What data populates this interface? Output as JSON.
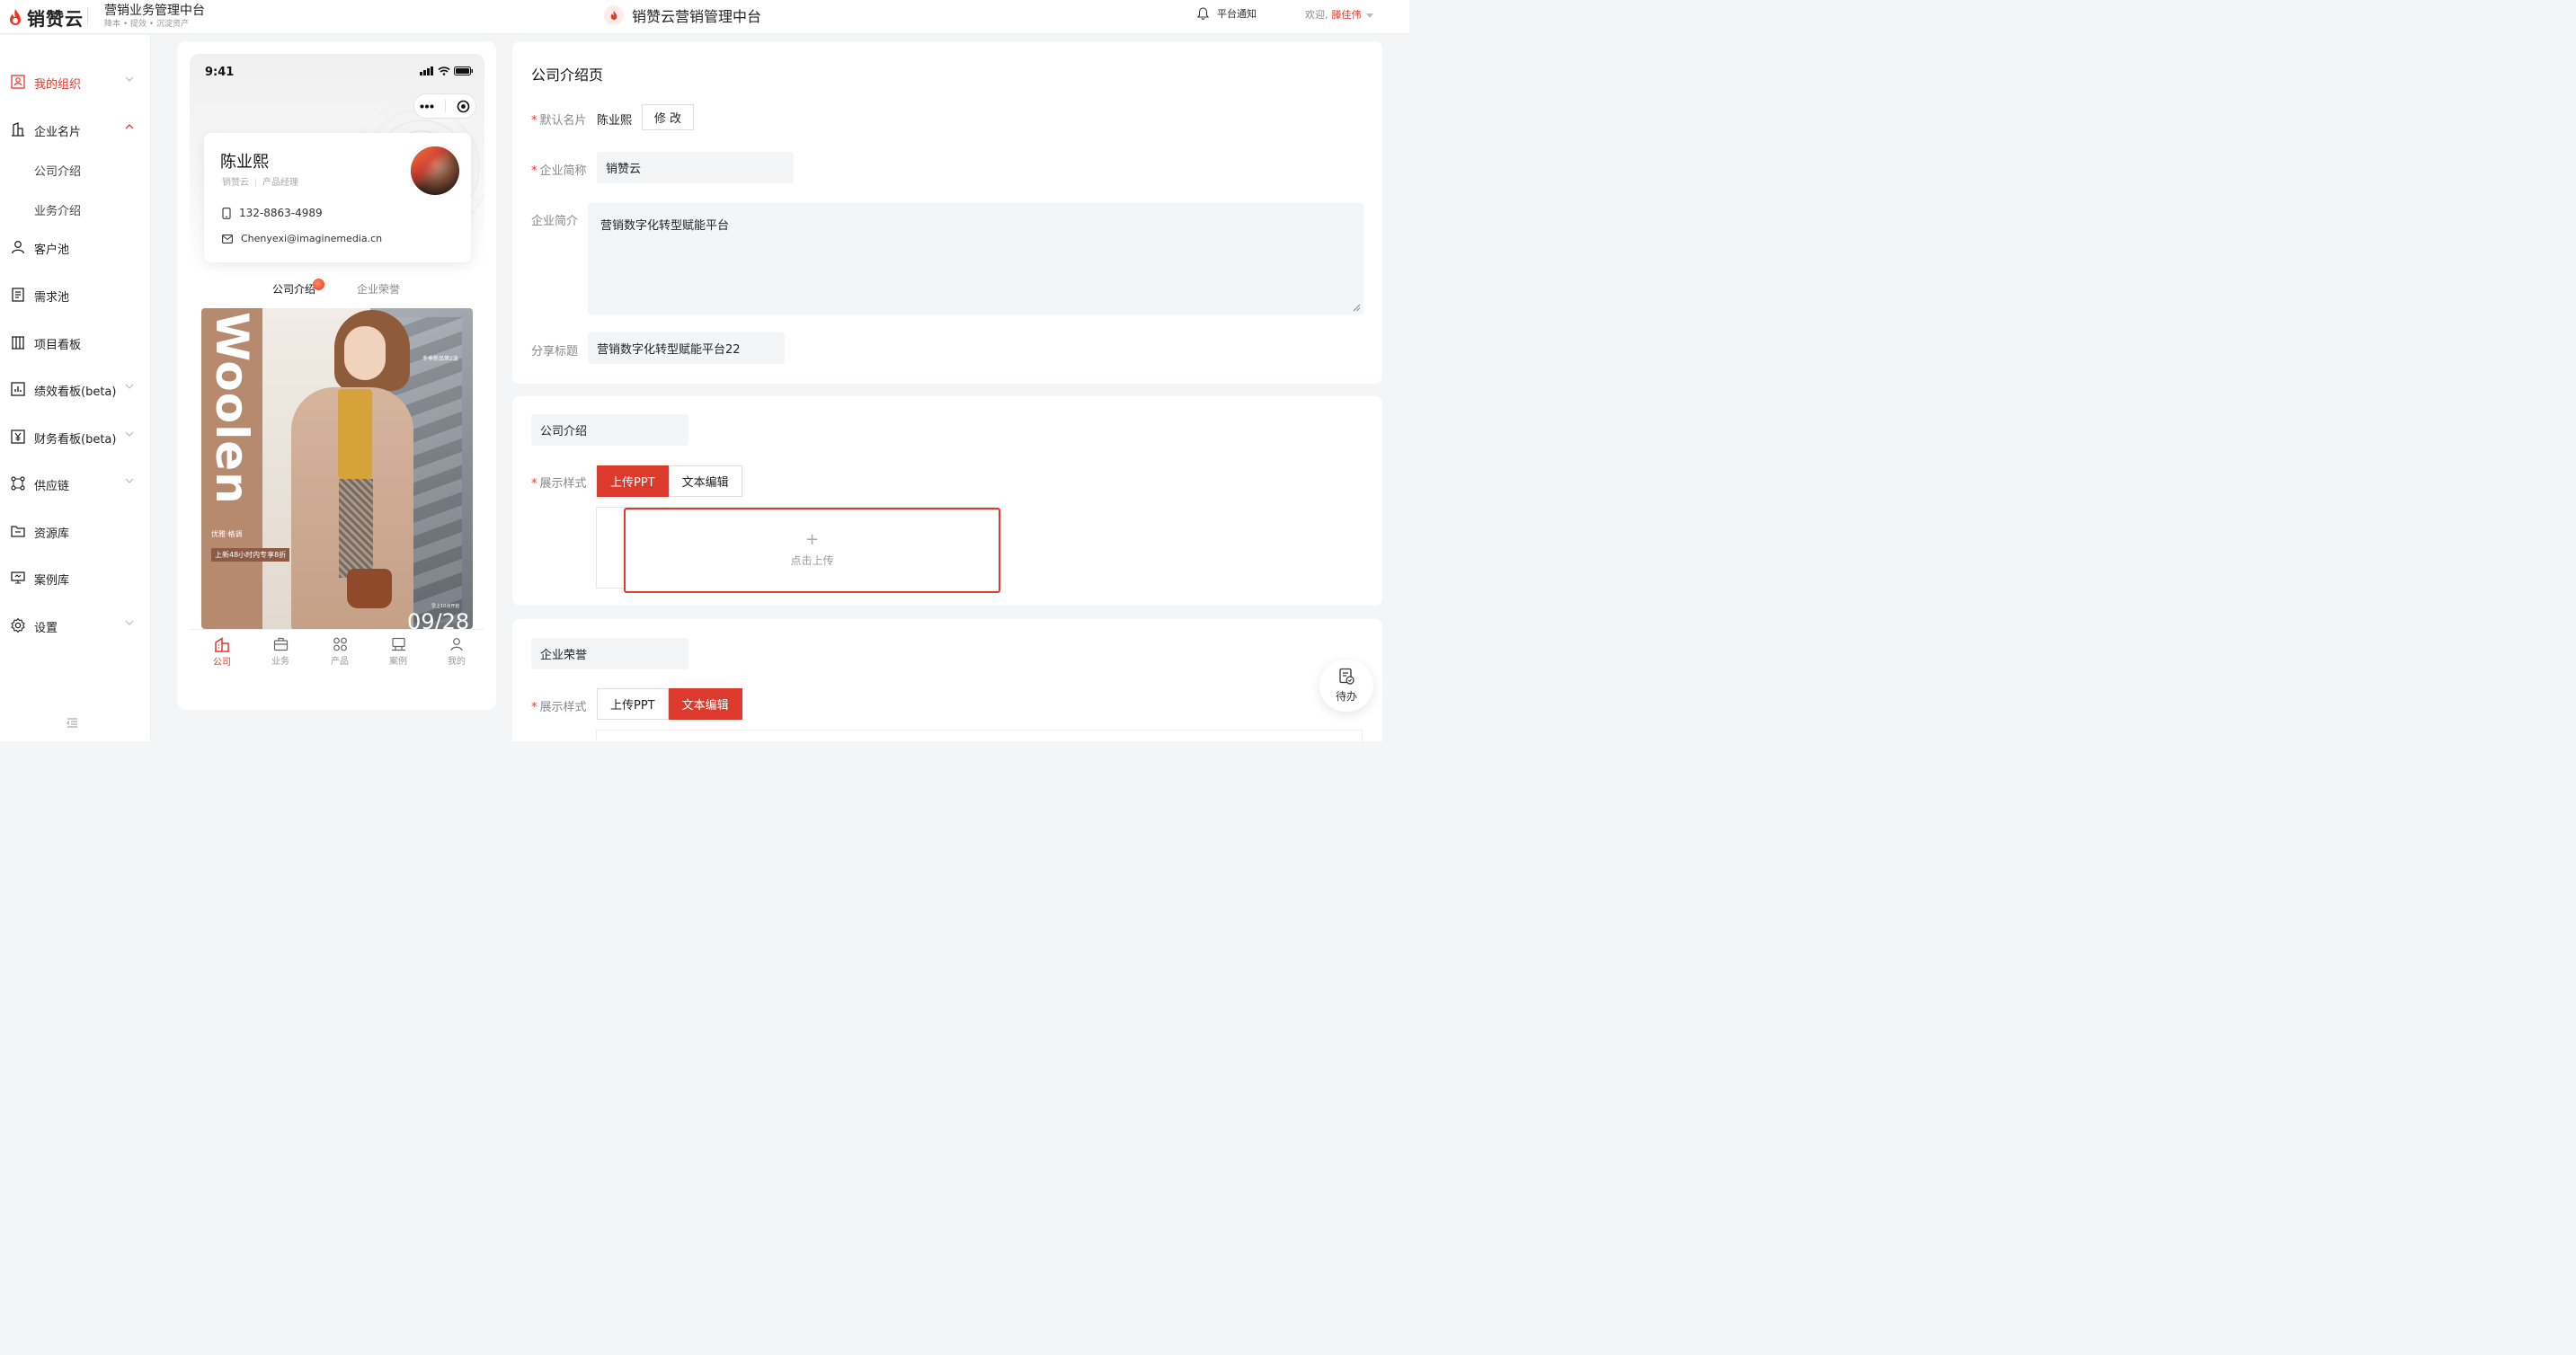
{
  "header": {
    "logo_text": "销赞云",
    "title": "营销业务管理中台",
    "subtitle": "降本 • 提效 • 沉淀资产",
    "center_title": "销赞云营销管理中台",
    "notice": "平台通知",
    "welcome": "欢迎,",
    "user_name": "滕佳伟"
  },
  "sidebar": {
    "items": [
      {
        "label": "我的组织",
        "icon": "org-icon"
      },
      {
        "label": "企业名片",
        "icon": "building-icon"
      },
      {
        "label": "公司介绍"
      },
      {
        "label": "业务介绍"
      },
      {
        "label": "客户池",
        "icon": "user-icon"
      },
      {
        "label": "需求池",
        "icon": "doc-icon"
      },
      {
        "label": "项目看板",
        "icon": "board-icon"
      },
      {
        "label": "绩效看板(beta)",
        "icon": "chart-icon"
      },
      {
        "label": "财务看板(beta)",
        "icon": "yen-icon"
      },
      {
        "label": "供应链",
        "icon": "network-icon"
      },
      {
        "label": "资源库",
        "icon": "folder-icon"
      },
      {
        "label": "案例库",
        "icon": "screen-icon"
      },
      {
        "label": "设置",
        "icon": "gear-icon"
      }
    ]
  },
  "phone": {
    "time": "9:41",
    "name": "陈业熙",
    "company": "销赞云",
    "role": "产品经理",
    "phone": "132-8863-4989",
    "email": "Chenyexi@imaginemedia.cn",
    "tab_active": "公司介绍",
    "tab_other": "企业荣誉",
    "poster": {
      "brand": "Woolen",
      "tag1": "优雅·格调",
      "tag2": "上新48小时内专享8折",
      "top_right": "冬季新品第2波",
      "bottom_right": "早上10点开抢",
      "date": "09/28"
    },
    "tabbar": [
      {
        "label": "公司",
        "icon": "home-icon"
      },
      {
        "label": "业务",
        "icon": "briefcase-icon"
      },
      {
        "label": "产品",
        "icon": "grid-icon"
      },
      {
        "label": "案例",
        "icon": "case-icon"
      },
      {
        "label": "我的",
        "icon": "person-icon"
      }
    ]
  },
  "form": {
    "page_title": "公司介绍页",
    "default_card_label": "默认名片",
    "default_card_value": "陈业熙",
    "edit_button": "修 改",
    "short_name_label": "企业简称",
    "short_name_value": "销赞云",
    "intro_label": "企业简介",
    "intro_value": "营销数字化转型赋能平台",
    "share_title_label": "分享标题",
    "share_title_value": "营销数字化转型赋能平台22"
  },
  "section_intro": {
    "title": "公司介绍",
    "style_label": "展示样式",
    "opt_ppt": "上传PPT",
    "opt_text": "文本编辑",
    "upload_plus": "+",
    "upload_text": "点击上传"
  },
  "section_honor": {
    "title": "企业荣誉",
    "style_label": "展示样式",
    "opt_ppt": "上传PPT",
    "opt_text": "文本编辑"
  },
  "todo": {
    "label": "待办"
  },
  "colors": {
    "accent": "#e6372a",
    "accent_button": "#dc3a2c"
  }
}
